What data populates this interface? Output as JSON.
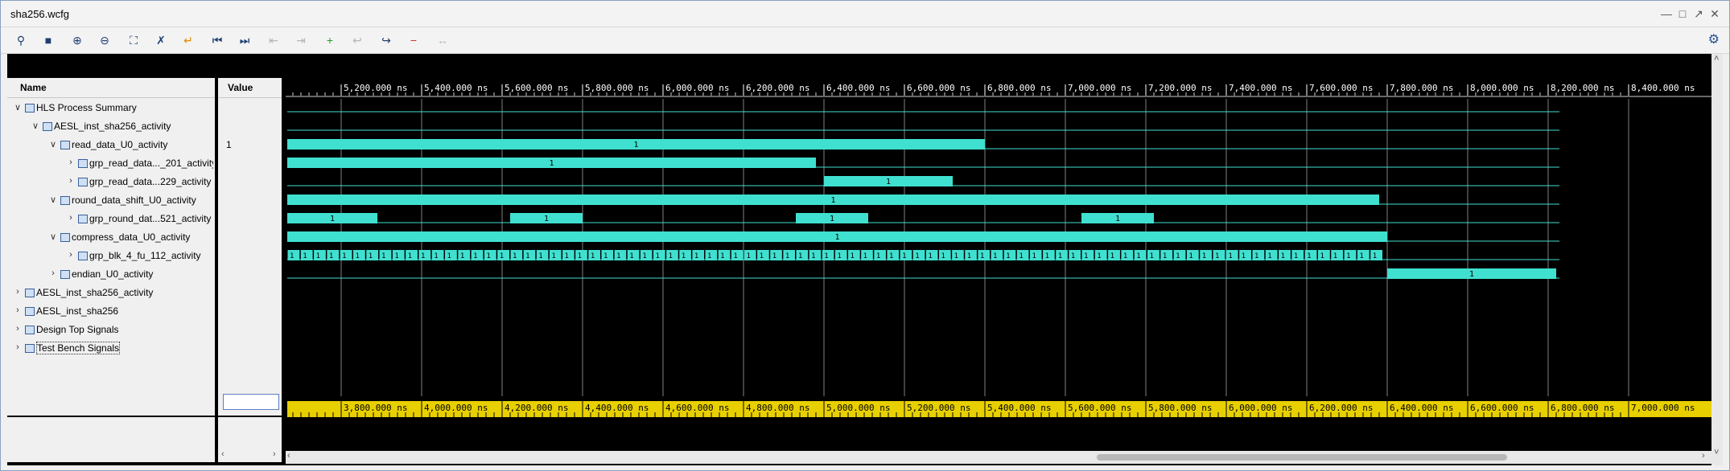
{
  "window": {
    "title": "sha256.wcfg"
  },
  "toolbar_icons": [
    "search-icon",
    "save-icon",
    "zoom-in-icon",
    "zoom-out-icon",
    "zoom-fit-icon",
    "cursor-snap-icon",
    "goto-cursor-icon",
    "goto-start-icon",
    "goto-end-icon",
    "prev-transition-icon",
    "next-transition-icon",
    "add-marker-icon",
    "prev-marker-icon",
    "next-marker-icon",
    "delete-marker-icon",
    "swap-cursor-icon",
    "settings-icon"
  ],
  "columns": {
    "name": "Name",
    "value": "Value"
  },
  "rows": [
    {
      "label": "HLS Process Summary",
      "value": ""
    },
    {
      "label": "AESL_inst_sha256_activity",
      "value": ""
    },
    {
      "label": "read_data_U0_activity",
      "value": "1"
    },
    {
      "label": "grp_read_data..._201_activity",
      "value": ""
    },
    {
      "label": "grp_read_data...229_activity",
      "value": ""
    },
    {
      "label": "round_data_shift_U0_activity",
      "value": ""
    },
    {
      "label": "grp_round_dat...521_activity",
      "value": ""
    },
    {
      "label": "compress_data_U0_activity",
      "value": ""
    },
    {
      "label": "grp_blk_4_fu_112_activity",
      "value": ""
    },
    {
      "label": "endian_U0_activity",
      "value": ""
    },
    {
      "label": "AESL_inst_sha256_activity",
      "value": ""
    },
    {
      "label": "AESL_inst_sha256",
      "value": ""
    },
    {
      "label": "Design Top Signals",
      "value": ""
    },
    {
      "label": "Test Bench Signals",
      "value": ""
    }
  ],
  "top_ruler": [
    "5,200.000 ns",
    "5,400.000 ns",
    "5,600.000 ns",
    "5,800.000 ns",
    "6,000.000 ns",
    "6,200.000 ns",
    "6,400.000 ns",
    "6,600.000 ns",
    "6,800.000 ns",
    "7,000.000 ns",
    "7,200.000 ns",
    "7,400.000 ns",
    "7,600.000 ns",
    "7,800.000 ns",
    "8,000.000 ns",
    "8,200.000 ns",
    "8,400.000 ns"
  ],
  "bottom_ruler": [
    "3,800.000 ns",
    "4,000.000 ns",
    "4,200.000 ns",
    "4,400.000 ns",
    "4,600.000 ns",
    "4,800.000 ns",
    "5,000.000 ns",
    "5,200.000 ns",
    "5,400.000 ns",
    "5,600.000 ns",
    "5,800.000 ns",
    "6,000.000 ns",
    "6,200.000 ns",
    "6,400.000 ns",
    "6,600.000 ns",
    "6,800.000 ns",
    "7,000.000 ns"
  ],
  "bus_value": "1",
  "colors": {
    "wave": "#40e0d0",
    "ruler_bar": "#e8d000",
    "grid": "#808080",
    "background": "#000000"
  }
}
